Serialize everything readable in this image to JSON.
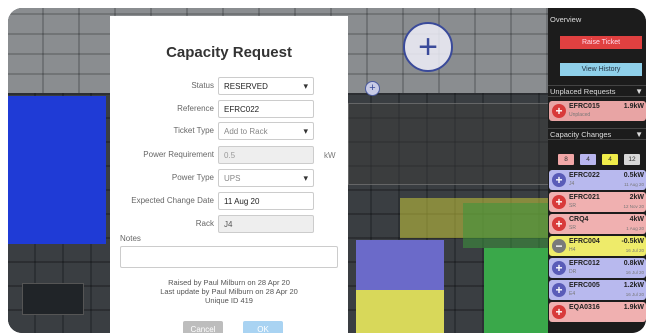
{
  "modal": {
    "title": "Capacity Request",
    "fields": {
      "status": {
        "label": "Status",
        "value": "RESERVED"
      },
      "reference": {
        "label": "Reference",
        "value": "EFRC022"
      },
      "ticket_type": {
        "label": "Ticket Type",
        "value": "Add to Rack"
      },
      "power_requirement": {
        "label": "Power Requirement",
        "value": "0.5",
        "unit": "kW"
      },
      "power_type": {
        "label": "Power Type",
        "value": "UPS"
      },
      "expected_change_date": {
        "label": "Expected Change Date",
        "value": "11 Aug 20"
      },
      "rack": {
        "label": "Rack",
        "value": "J4"
      }
    },
    "notes_label": "Notes",
    "raised_by": "Raised by Paul Milburn on 28 Apr 20",
    "last_update": "Last update by Paul Milburn on 28 Apr 20",
    "unique_id": "Unique ID 419",
    "cancel_label": "Cancel",
    "ok_label": "OK"
  },
  "scene": {
    "add_icon": "plus-circle-icon"
  },
  "panel": {
    "overview_title": "Overview",
    "raise_ticket_label": "Raise Ticket",
    "view_history_label": "View History",
    "unplaced_title": "Unplaced Requests",
    "unplaced": [
      {
        "name": "EFRC015",
        "sub": "Unplaced",
        "value": "1.9kW",
        "date": "",
        "icon": "+",
        "color": "#e8a4a4"
      }
    ],
    "capacity_title": "Capacity Changes",
    "chips": [
      {
        "label": "8",
        "bg": "#f2a7a7"
      },
      {
        "label": "4",
        "bg": "#b9b6ef"
      },
      {
        "label": "4",
        "bg": "#f0ec4a"
      },
      {
        "label": "12",
        "bg": "#d8d8d8"
      }
    ],
    "changes": [
      {
        "name": "EFRC022",
        "sub": "J4",
        "value": "0.5kW",
        "date": "11 Aug 20",
        "icon": "+",
        "bg": "#b8b9ee",
        "icon_bg": "#5a5cb8"
      },
      {
        "name": "EFRC021",
        "sub": "SR",
        "value": "2kW",
        "date": "12 Nov 20",
        "icon": "+",
        "bg": "#f0b0b0",
        "icon_bg": "#d83a3a"
      },
      {
        "name": "CRQ4",
        "sub": "SR",
        "value": "4kW",
        "date": "1 Aug 20",
        "icon": "+",
        "bg": "#f0b0b0",
        "icon_bg": "#d83a3a"
      },
      {
        "name": "EFRC004",
        "sub": "H4",
        "value": "-0.5kW",
        "date": "16 Jul 20",
        "icon": "−",
        "bg": "#eeeb6a",
        "icon_bg": "#7a7a7a"
      },
      {
        "name": "EFRC012",
        "sub": "DR",
        "value": "0.8kW",
        "date": "16 Jul 20",
        "icon": "+",
        "bg": "#b8b9ee",
        "icon_bg": "#5a5cb8"
      },
      {
        "name": "EFRC005",
        "sub": "E4",
        "value": "1.2kW",
        "date": "16 Jul 20",
        "icon": "+",
        "bg": "#b8b9ee",
        "icon_bg": "#5a5cb8"
      },
      {
        "name": "EQA0316",
        "sub": "",
        "value": "1.9kW",
        "date": "",
        "icon": "+",
        "bg": "#f0b0b0",
        "icon_bg": "#d83a3a"
      }
    ]
  }
}
